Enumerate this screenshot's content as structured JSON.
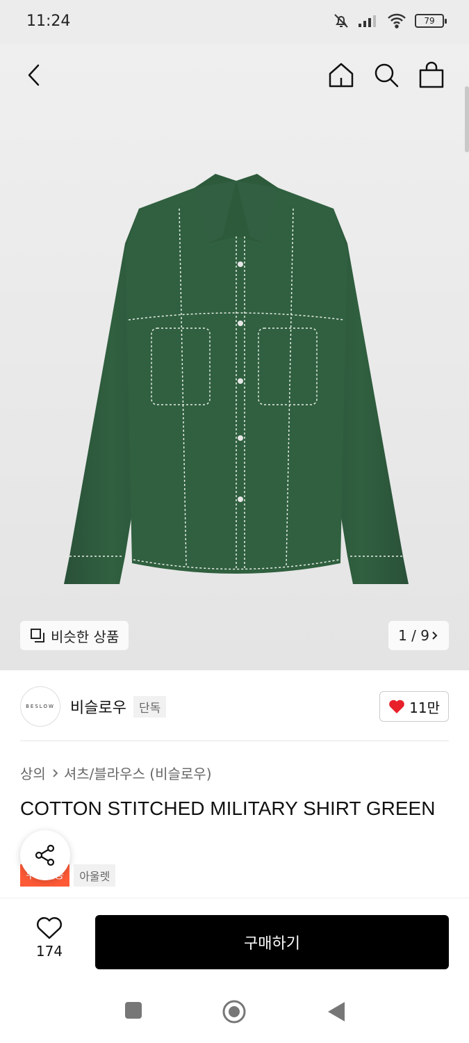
{
  "status_bar": {
    "time": "11:24",
    "battery": "79",
    "icons": [
      "bell-off-icon",
      "signal-icon",
      "wifi-icon",
      "battery-icon"
    ]
  },
  "top_nav": {
    "icons": [
      "back-arrow-icon",
      "home-icon",
      "search-icon",
      "shopping-bag-icon"
    ]
  },
  "gallery": {
    "similar_label": "비슷한 상품",
    "pager": "1 / 9",
    "shirt_color": "#2f5a40"
  },
  "brand": {
    "logo_text": "BESLOW",
    "name": "비슬로우",
    "tag": "단독",
    "likes": "11만"
  },
  "breadcrumb": {
    "category": "상의",
    "subcategory": "셔츠/블라우스 (비슬로우)"
  },
  "product": {
    "title": "COTTON STITCHED MILITARY SHIRT GREEN",
    "badges": [
      "무료배송",
      "아울렛"
    ]
  },
  "bottom_bar": {
    "wish_count": "174",
    "buy_label": "구매하기"
  },
  "colors": {
    "accent_red": "#ff5a36",
    "heart_red": "#e8202a",
    "buy_button": "#000000"
  }
}
